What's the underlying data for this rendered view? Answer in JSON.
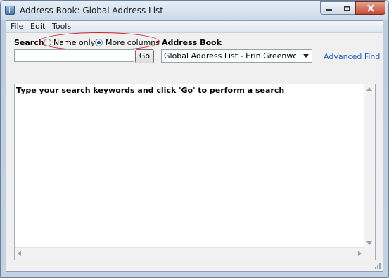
{
  "window": {
    "title": "Address Book: Global Address List"
  },
  "icons": {
    "app": "address-book-icon",
    "minimize": "minimize-icon",
    "maximize": "maximize-icon",
    "close": "close-icon"
  },
  "menu": {
    "file": "File",
    "edit": "Edit",
    "tools": "Tools"
  },
  "search": {
    "label": "Search:",
    "name_only": "Name only",
    "more_columns": "More columns",
    "selected": "more_columns",
    "input_value": "",
    "go_label": "Go"
  },
  "address_book": {
    "label": "Address Book",
    "selected": "Global Address List - Erin.Greenwood@sho"
  },
  "advanced_find": "Advanced Find",
  "results": {
    "message": "Type your search keywords and click 'Go' to perform a search"
  },
  "colors": {
    "link": "#2160b8",
    "annotation": "#d2232a",
    "radio_selected": "#1f4f9e"
  }
}
